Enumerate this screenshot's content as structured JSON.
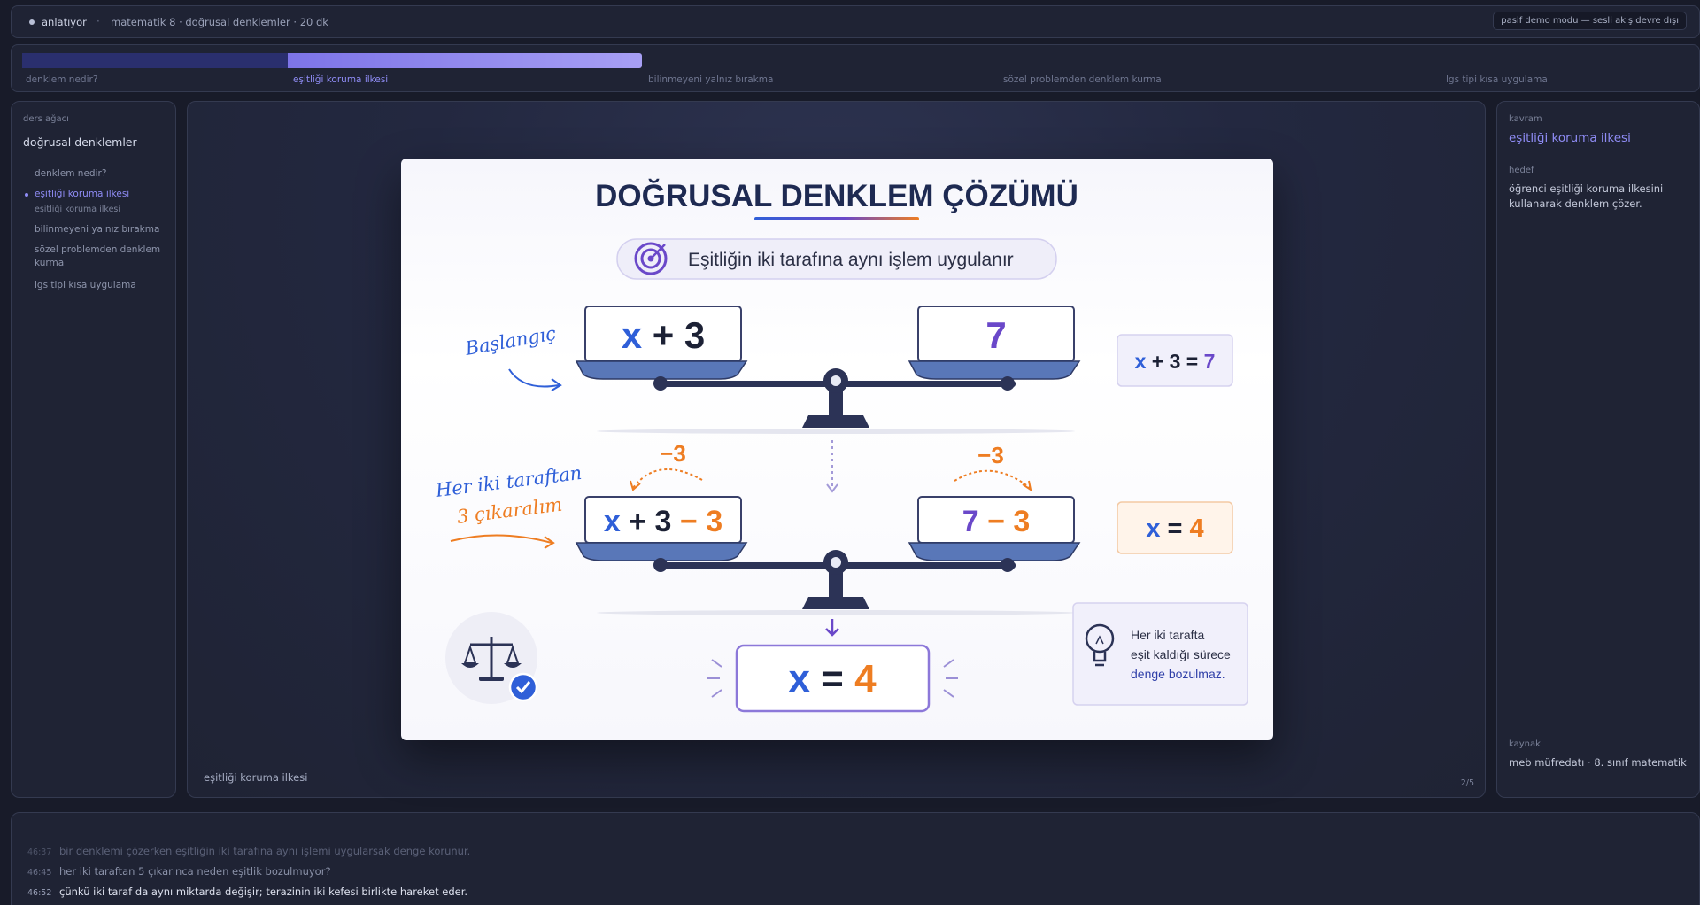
{
  "topbar": {
    "status": "anlatıyor",
    "separator": "·",
    "breadcrumb": "matematik 8 · doğrusal denklemler · 20 dk",
    "demo_badge": "pasif demo modu — sesli akış devre dışı"
  },
  "progress": {
    "completed_fraction": 0.4,
    "steps": [
      {
        "label": "denklem nedir?",
        "state": "done"
      },
      {
        "label": "eşitliği koruma ilkesi",
        "state": "active"
      },
      {
        "label": "bilinmeyeni yalnız bırakma",
        "state": "upcoming"
      },
      {
        "label": "sözel problemden denklem kurma",
        "state": "upcoming"
      },
      {
        "label": "lgs tipi kısa uygulama",
        "state": "upcoming"
      }
    ]
  },
  "lesson_tree": {
    "title": "ders ağacı",
    "course": "doğrusal denklemler",
    "items": [
      {
        "label": "denklem nedir?",
        "active": false
      },
      {
        "label": "eşitliği koruma ilkesi",
        "active": true
      },
      {
        "label": "eşitliği koruma ilkesi",
        "sub": true
      },
      {
        "label": "bilinmeyeni yalnız bırakma",
        "active": false
      },
      {
        "label": "sözel problemden denklem kurma",
        "active": false
      },
      {
        "label": "lgs tipi kısa uygulama",
        "active": false
      }
    ]
  },
  "stage": {
    "caption": "eşitliği koruma ilkesi",
    "counter": "2/5"
  },
  "slide": {
    "title": "DOĞRUSAL DENKLEM ÇÖZÜMÜ",
    "subtitle": "Eşitliğin iki tarafına aynı işlem uygulanır",
    "start_label": "Başlangıç",
    "step_label_line1": "Her iki taraftan",
    "step_label_line2": "3 çıkaralım",
    "minus_left": "−3",
    "minus_right": "−3",
    "right_pan_top": "7",
    "eq_start": "x + 3 = 7",
    "eq_step": "x = 4",
    "final": "x = 4",
    "tip_line1": "Her iki tarafta",
    "tip_line2": "eşit kaldığı sürece",
    "tip_line3": "denge bozulmaz.",
    "colors": {
      "x": "#2f5fd8",
      "num": "#1c2135",
      "accent_orange": "#ee7d22",
      "accent_purple": "#6a48c9"
    }
  },
  "concept": {
    "label": "kavram",
    "value": "eşitliği koruma ilkesi",
    "goal_label": "hedef",
    "goal": "öğrenci eşitliği koruma ilkesini kullanarak denklem çözer.",
    "source_label": "kaynak",
    "source": "meb müfredatı · 8. sınıf matematik"
  },
  "transcript": [
    {
      "time": "46:37",
      "text": "bir denklemi çözerken eşitliğin iki tarafına aynı işlemi uygularsak denge korunur."
    },
    {
      "time": "46:45",
      "text": "her iki taraftan 5 çıkarınca neden eşitlik bozulmuyor?"
    },
    {
      "time": "46:52",
      "text": "çünkü iki taraf da aynı miktarda değişir; terazinin iki kefesi birlikte hareket eder."
    }
  ]
}
